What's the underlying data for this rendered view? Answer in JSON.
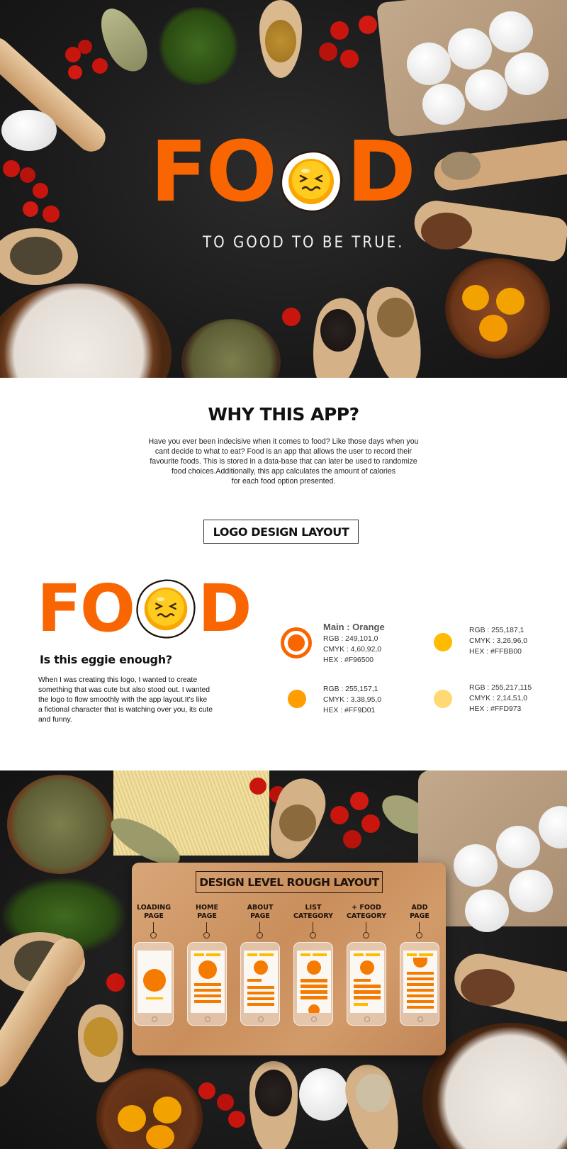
{
  "brand": {
    "name_letters": [
      "F",
      "O",
      "O",
      "D"
    ],
    "tagline": "TO GOOD TO BE TRUE.",
    "mascot": "egg-yolk-face",
    "colors": {
      "orange": "#F96500",
      "yolk": "#FFBB00",
      "mid": "#FF9D01",
      "light": "#FFD973"
    }
  },
  "why": {
    "title": "WHY THIS APP?",
    "lines": [
      "Have you ever been indecisive when it comes to food? Like those days when you",
      "cant decide to what to eat? Food is an app that allows the user to record their",
      "favourite foods. This is stored in a data-base that can later be used to randomize",
      "food choices.Additionally, this app calculates the amount of calories",
      "for each food option presented."
    ]
  },
  "logo_section": {
    "title": "LOGO DESIGN LAYOUT",
    "subtitle": "Is this eggie enough?",
    "lines": [
      "When I was creating this logo, I wanted to create",
      "something that was cute but also stood out. I wanted",
      "the logo to flow smoothly with the app layout.It's like",
      "a fictional character that is watching over you, its cute",
      "and funny."
    ],
    "swatches": [
      {
        "title": "Main : Orange",
        "rgb": "RGB : 249,101,0",
        "cmyk": "CMYK : 4,60,92,0",
        "hex": "HEX : #F96500",
        "color": "#F96500"
      },
      {
        "rgb": "RGB : 255,187,1",
        "cmyk": "CMYK : 3,26,96,0",
        "hex": "HEX : #FFBB00",
        "color": "#FFBB00"
      },
      {
        "rgb": "RGB : 255,157,1",
        "cmyk": "CMYK : 3,38,95,0",
        "hex": "HEX : #FF9D01",
        "color": "#FF9D01"
      },
      {
        "rgb": "RGB : 255,217,115",
        "cmyk": "CMYK : 2,14,51,0",
        "hex": "HEX : #FFD973",
        "color": "#FFD973"
      }
    ]
  },
  "rough_layout": {
    "title": "DESIGN LEVEL ROUGH LAYOUT",
    "screens": [
      {
        "line1": "LOADING",
        "line2": "PAGE"
      },
      {
        "line1": "HOME",
        "line2": "PAGE"
      },
      {
        "line1": "ABOUT",
        "line2": "PAGE"
      },
      {
        "line1": "LIST",
        "line2": "CATEGORY"
      },
      {
        "line1": "+ FOOD",
        "line2": "CATEGORY"
      },
      {
        "line1": "ADD",
        "line2": "PAGE"
      }
    ]
  }
}
